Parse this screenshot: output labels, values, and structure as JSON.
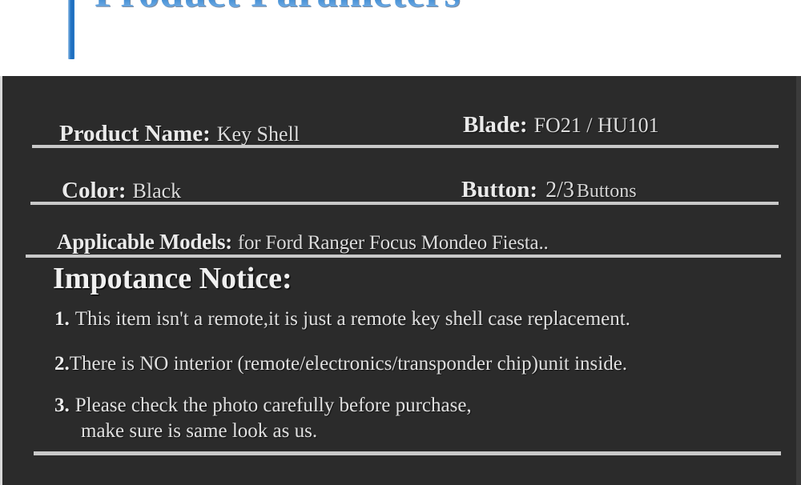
{
  "header": {
    "title": "Product Parameters",
    "accent_color": "#1a69bb",
    "title_gradient_top": "#0d4f9e",
    "title_gradient_bottom": "#8dbce9"
  },
  "panel": {
    "background_color": "#2b2b2b",
    "text_color": "#e0e0e0",
    "divider_color": "#c9c9c9"
  },
  "specs": {
    "rows": [
      {
        "left": {
          "label": "Product Name:",
          "value": "Key Shell"
        },
        "right": {
          "label": "Blade:",
          "value": "FO21 / HU101"
        }
      },
      {
        "left": {
          "label": "Color:",
          "value": "Black"
        },
        "right": {
          "label": "Button:",
          "value_primary": "2/3",
          "value_secondary": "Buttons"
        }
      }
    ],
    "models": {
      "label": "Applicable Models:",
      "value": "for Ford Ranger Focus Mondeo Fiesta.."
    }
  },
  "notice": {
    "heading": "Impotance Notice:",
    "items": [
      {
        "number": "1.",
        "text": "This item isn't a remote,it is just a remote key shell case replacement."
      },
      {
        "number": "2.",
        "text": "There is NO interior (remote/electronics/transponder chip)unit inside."
      },
      {
        "number": "3.",
        "text": "Please check the photo carefully before purchase,",
        "text_line2": "make sure is same look as us."
      }
    ]
  }
}
